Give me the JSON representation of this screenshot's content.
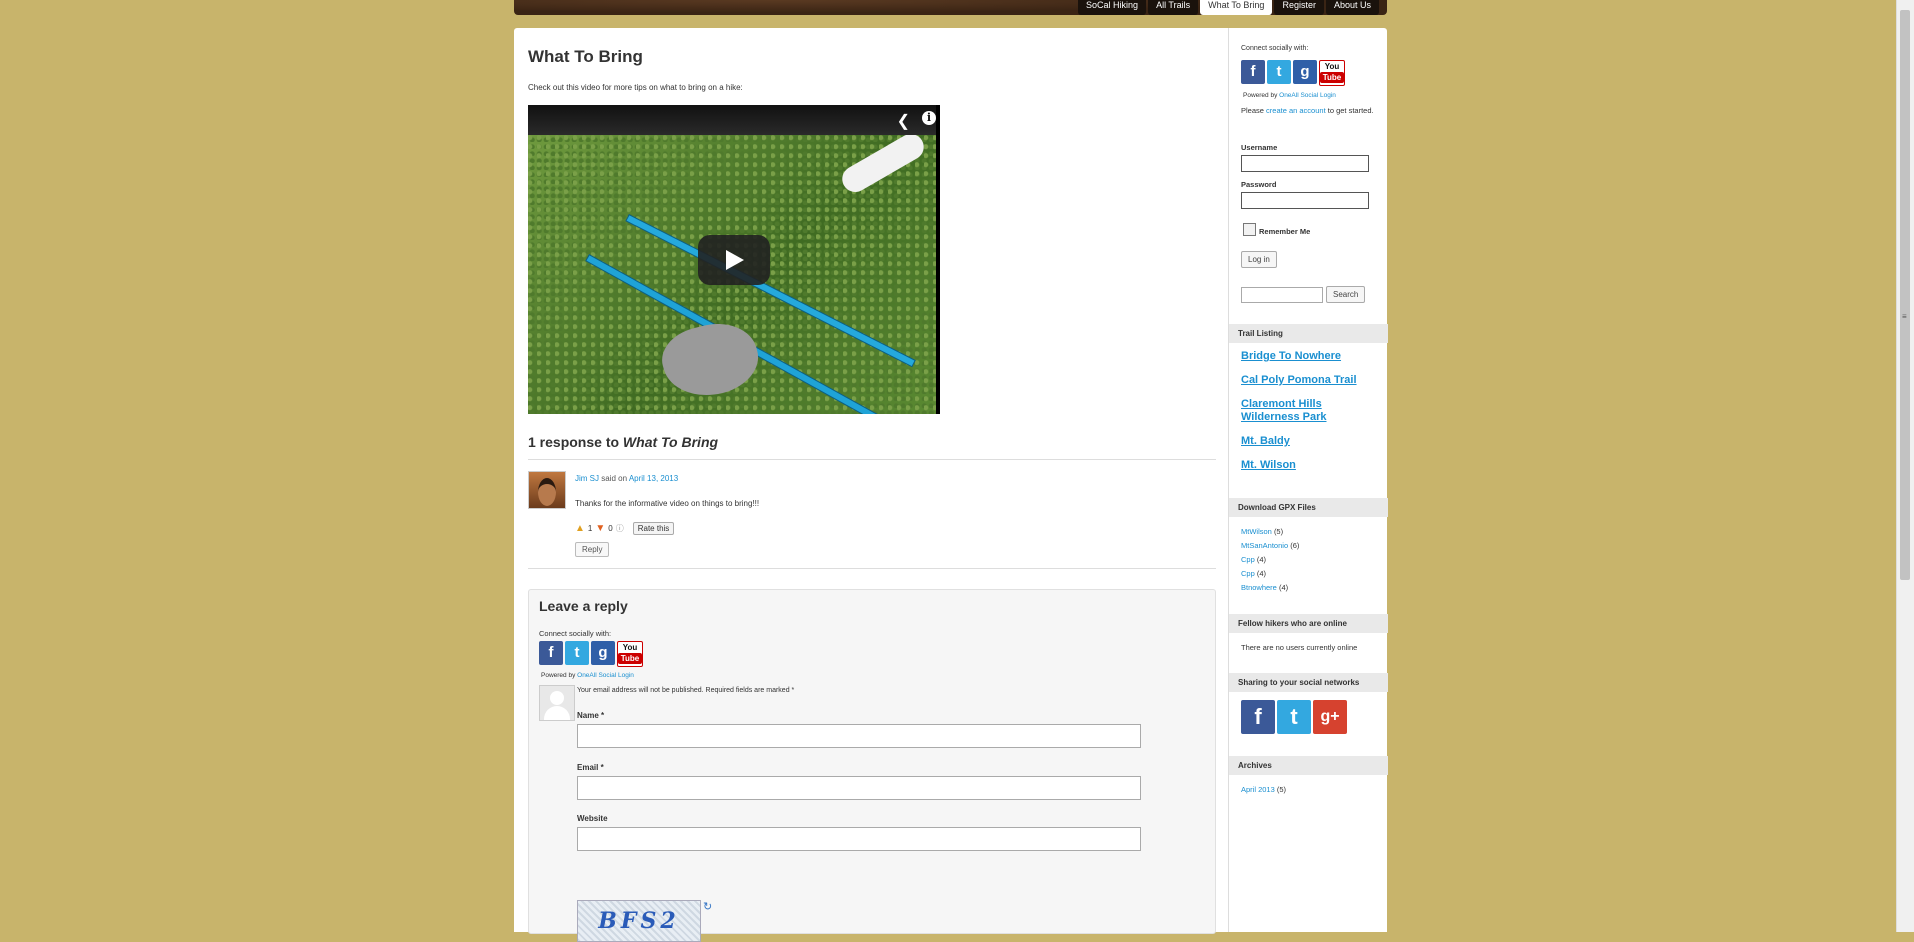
{
  "nav": {
    "items": [
      {
        "label": "SoCal Hiking",
        "active": false
      },
      {
        "label": "All Trails",
        "active": false
      },
      {
        "label": "What To Bring",
        "active": true
      },
      {
        "label": "Register",
        "active": false
      },
      {
        "label": "About Us",
        "active": false
      }
    ]
  },
  "post": {
    "title": "What To Bring",
    "intro": "Check out this video for more tips on what to bring on a hike:"
  },
  "responses": {
    "prefix": "1 response to ",
    "title": "What To Bring"
  },
  "comment": {
    "author": "Jim SJ",
    "said_on": " said on ",
    "date": "April 13, 2013",
    "text": "Thanks for the informative video on things to bring!!!",
    "likes": "1",
    "dislikes": "0",
    "rate_label": "Rate this",
    "reply_label": "Reply"
  },
  "reply_form": {
    "heading": "Leave a reply",
    "connect": "Connect socially with:",
    "powered_prefix": "Powered by ",
    "powered_link": "OneAll Social Login",
    "notice": "Your email address will not be published. Required fields are marked *",
    "name_label": "Name *",
    "email_label": "Email *",
    "website_label": "Website",
    "captcha_text": "BFS2"
  },
  "sidebar": {
    "connect": "Connect socially with:",
    "powered_prefix": "Powered by ",
    "powered_link": "OneAll Social Login",
    "please": "Please ",
    "create_account": "create an account",
    "to_get_started": " to get started.",
    "username_label": "Username",
    "password_label": "Password",
    "remember_label": "Remember Me",
    "login_label": "Log in",
    "search_label": "Search",
    "trail_heading": "Trail Listing",
    "trails": [
      "Bridge To Nowhere",
      "Cal Poly Pomona Trail",
      "Claremont Hills Wilderness Park",
      "Mt. Baldy",
      "Mt. Wilson"
    ],
    "gpx_heading": "Download GPX Files",
    "gpx": [
      {
        "name": "MtWilson",
        "count": "(5)"
      },
      {
        "name": "MtSanAntonio",
        "count": "(6)"
      },
      {
        "name": "Cpp",
        "count": "(4)"
      },
      {
        "name": "Cpp",
        "count": "(4)"
      },
      {
        "name": "Btnowhere",
        "count": "(4)"
      }
    ],
    "online_heading": "Fellow hikers who are online",
    "online_text": "There are no users currently online",
    "sharing_heading": "Sharing to your social networks",
    "archives_heading": "Archives",
    "archive_link": "April 2013",
    "archive_count": "(5)"
  },
  "icons": {
    "facebook": "f",
    "twitter": "t",
    "google": "g",
    "youtube_top": "You",
    "youtube_bottom": "Tube",
    "gplus": "g+"
  },
  "colors": {
    "page_bg": "#c8b46b",
    "link": "#1a8fd0",
    "nav_bg": "#3a2414"
  }
}
